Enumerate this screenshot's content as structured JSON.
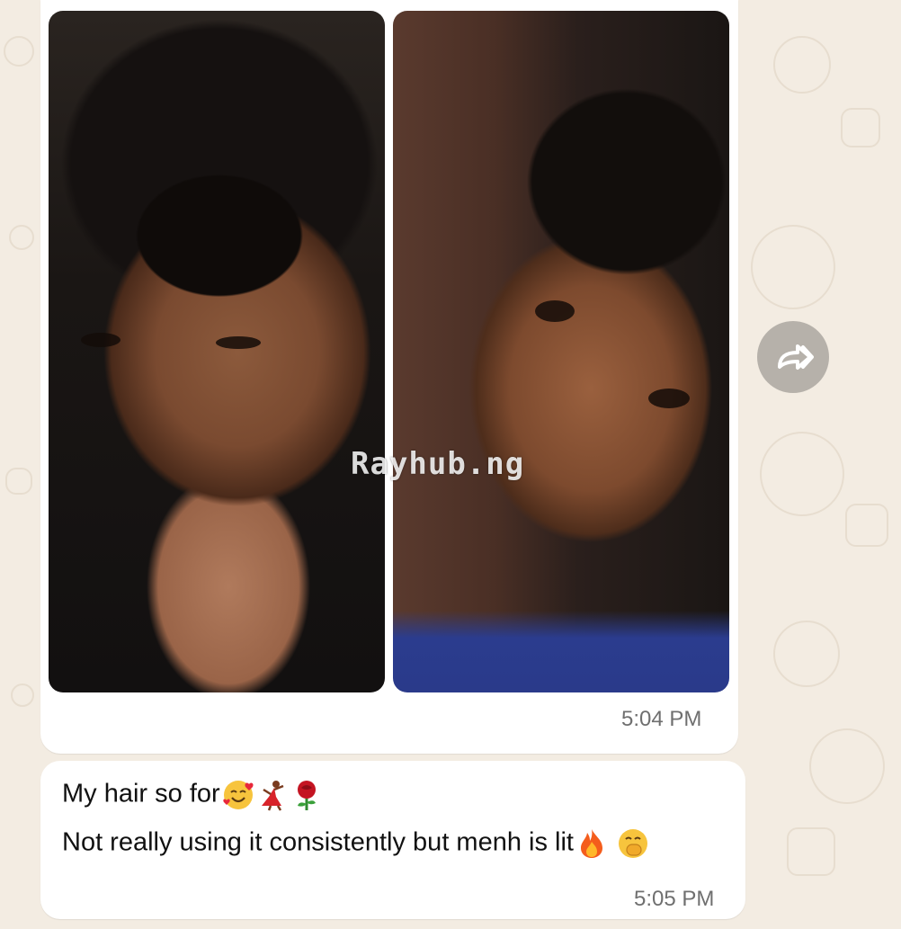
{
  "chat": {
    "media_message": {
      "watermark": "Rayhub.ng",
      "time": "5:04 PM"
    },
    "text_message": {
      "line1": "My hair so for",
      "line2": "Not really using it consistently but menh is lit",
      "time": "5:05 PM",
      "line1_emojis": [
        "smiling-face-with-hearts-icon",
        "dancer-icon",
        "rose-icon"
      ],
      "line2_emojis": [
        "fire-icon",
        "face-with-hand-over-mouth-icon"
      ]
    },
    "actions": {
      "forward_icon": "forward-icon"
    }
  },
  "colors": {
    "wallpaper": "#f3ece2",
    "bubble": "#ffffff",
    "timestamp": "#6f6f6f",
    "forward_button": "#b6b1aa"
  }
}
